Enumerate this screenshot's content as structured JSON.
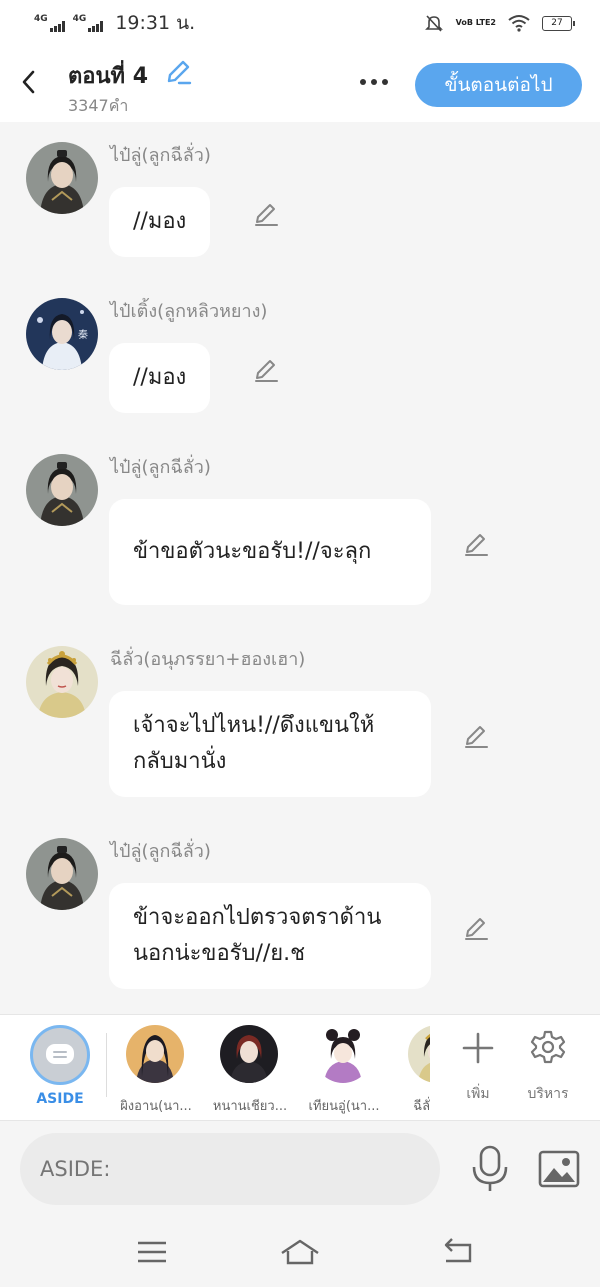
{
  "status_bar": {
    "network1": "4G",
    "network2": "4G",
    "time": "19:31 น.",
    "volte": "VoB LTE2",
    "battery": "27"
  },
  "header": {
    "title": "ตอนที่ 4",
    "word_count": "3347คำ",
    "next_button": "ขั้นตอนต่อไป"
  },
  "messages": [
    {
      "sender": "ไป๋ลู่(ลูกฉีลั่ว)",
      "text": "//มอง",
      "avatar": "dark-haired-man-portrait"
    },
    {
      "sender": "ไป๋เติ้ง(ลูกหลิวหยาง)",
      "text": "//มอง",
      "avatar": "blue-robed-man-portrait"
    },
    {
      "sender": "ไป๋ลู่(ลูกฉีลั่ว)",
      "text": "ข้าขอตัวนะขอรับ!//จะลุก",
      "avatar": "dark-haired-man-portrait"
    },
    {
      "sender": "ฉีลั่ว(อนุภรรยา+ฮองเฮา)",
      "text": "เจ้าจะไปไหน!//ดึงแขนให้กลับมานั่ง",
      "avatar": "empress-portrait"
    },
    {
      "sender": "ไป๋ลู่(ลูกฉีลั่ว)",
      "text": "ข้าจะออกไปตรวจตราด้านนอกน่ะขอรับ//ย.ช",
      "avatar": "dark-haired-man-portrait"
    }
  ],
  "character_bar": {
    "aside_label": "ASIDE",
    "characters": [
      {
        "name": "ผิงอาน(นา...",
        "avatar": "long-haired-man-portrait"
      },
      {
        "name": "หนานเชียว...",
        "avatar": "red-haired-man-portrait"
      },
      {
        "name": "เทียนอู่(นา...",
        "avatar": "woman-bun-portrait"
      },
      {
        "name": "ฉีลั่ว(อ...",
        "avatar": "empress-portrait"
      }
    ],
    "add_label": "เพิ่ม",
    "manage_label": "บริหาร"
  },
  "input": {
    "placeholder": "ASIDE:"
  },
  "colors": {
    "accent": "#5aa6ee",
    "chat_bg": "#f5f5f5",
    "aside_label": "#3a8ee6"
  }
}
